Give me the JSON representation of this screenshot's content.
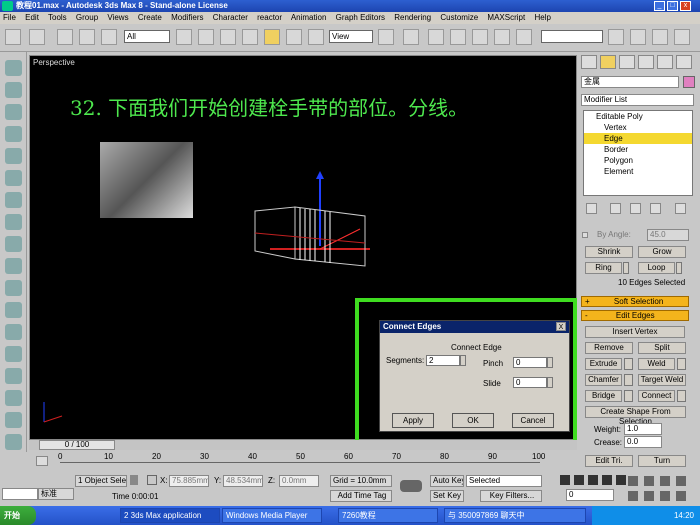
{
  "window": {
    "title": "教程01.max - Autodesk 3ds Max 8 - Stand-alone License"
  },
  "menu": [
    "File",
    "Edit",
    "Tools",
    "Group",
    "Views",
    "Create",
    "Modifiers",
    "Character",
    "reactor",
    "Animation",
    "Graph Editors",
    "Rendering",
    "Customize",
    "MAXScript",
    "Help"
  ],
  "toolbar": {
    "selection_filter": "All",
    "reference_coord": "View",
    "named_sel": ""
  },
  "viewport": {
    "label": "Perspective",
    "instruction": "32. 下面我们开始创建栓手带的部位。分线。"
  },
  "dialog": {
    "title": "Connect Edges",
    "group_label": "Connect Edge",
    "segments_label": "Segments:",
    "segments_value": "2",
    "pinch_label": "Pinch",
    "pinch_value": "0",
    "slide_label": "Slide",
    "slide_value": "0",
    "apply": "Apply",
    "ok": "OK",
    "cancel": "Cancel",
    "close_glyph": "X"
  },
  "command_panel": {
    "object_name": "金属",
    "modifier_list": "Modifier List",
    "stack": [
      "Editable Poly",
      "Vertex",
      "Edge",
      "Border",
      "Polygon",
      "Element"
    ],
    "selected_stack_item": "Edge",
    "by_angle_label": "By Angle:",
    "by_angle_value": "45.0",
    "shrink": "Shrink",
    "grow": "Grow",
    "ring": "Ring",
    "loop": "Loop",
    "edges_selected": "10 Edges Selected",
    "soft_selection": "Soft Selection",
    "edit_edges": "Edit Edges",
    "insert_vertex": "Insert Vertex",
    "remove": "Remove",
    "split": "Split",
    "extrude": "Extrude",
    "weld": "Weld",
    "chamfer": "Chamfer",
    "target_weld": "Target Weld",
    "bridge": "Bridge",
    "connect": "Connect",
    "create_shape": "Create Shape From Selection",
    "weight_label": "Weight:",
    "weight_value": "1.0",
    "crease_label": "Crease:",
    "crease_value": "0.0",
    "edit_tri": "Edit Tri.",
    "turn": "Turn",
    "plus": "+",
    "minus": "-"
  },
  "timeline": {
    "frame": "0 / 100",
    "ticks": [
      "0",
      "10",
      "20",
      "30",
      "40",
      "50",
      "60",
      "70",
      "80",
      "90",
      "100"
    ]
  },
  "status": {
    "selection": "1 Object Sele",
    "x_label": "X:",
    "x_value": "75.885mm",
    "y_label": "Y:",
    "y_value": "48.534mm",
    "z_label": "Z:",
    "z_value": "0.0mm",
    "grid": "Grid = 10.0mm",
    "auto_key": "Auto Key",
    "set_key": "Set Key",
    "selected": "Selected",
    "key_filters": "Key Filters...",
    "add_time_tag": "Add Time Tag",
    "time": "Time 0:00:01",
    "ime": "标准",
    "frame_value": "0"
  },
  "taskbar": {
    "start": "开始",
    "tasks": [
      "2 3ds Max application",
      "Windows Media Player",
      "7260教程",
      "与 350097869 聊天中"
    ],
    "clock": "14:20"
  }
}
